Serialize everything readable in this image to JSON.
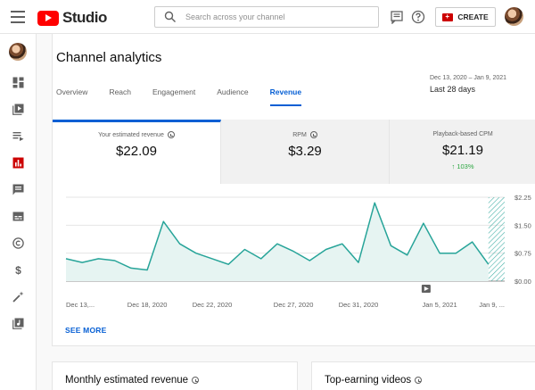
{
  "header": {
    "app_name": "Studio",
    "search_placeholder": "Search across your channel",
    "create_label": "CREATE"
  },
  "sidebar": {
    "items": [
      {
        "name": "dashboard",
        "active": false
      },
      {
        "name": "content",
        "active": false
      },
      {
        "name": "playlists",
        "active": false
      },
      {
        "name": "analytics",
        "active": true
      },
      {
        "name": "comments",
        "active": false
      },
      {
        "name": "subtitles",
        "active": false
      },
      {
        "name": "copyright",
        "active": false
      },
      {
        "name": "monetization",
        "active": false
      },
      {
        "name": "customization",
        "active": false
      },
      {
        "name": "audio-library",
        "active": false
      }
    ]
  },
  "page": {
    "title": "Channel analytics",
    "tabs": [
      {
        "label": "Overview",
        "active": false
      },
      {
        "label": "Reach",
        "active": false
      },
      {
        "label": "Engagement",
        "active": false
      },
      {
        "label": "Audience",
        "active": false
      },
      {
        "label": "Revenue",
        "active": true
      }
    ],
    "range_dates": "Dec 13, 2020 – Jan 9, 2021",
    "range_label": "Last 28 days",
    "see_more": "SEE MORE"
  },
  "metrics": [
    {
      "title": "Your estimated revenue",
      "value": "$22.09",
      "delta": ""
    },
    {
      "title": "RPM",
      "value": "$3.29",
      "delta": ""
    },
    {
      "title": "Playback-based CPM",
      "value": "$21.19",
      "delta": "103%"
    }
  ],
  "colors": {
    "accent": "#065fd4",
    "brand": "#ff0000",
    "line": "#27a499",
    "positive": "#2ba640"
  },
  "chart_data": {
    "type": "area",
    "x": [
      "Dec 13, 2020",
      "Dec 14, 2020",
      "Dec 15, 2020",
      "Dec 16, 2020",
      "Dec 17, 2020",
      "Dec 18, 2020",
      "Dec 19, 2020",
      "Dec 20, 2020",
      "Dec 21, 2020",
      "Dec 22, 2020",
      "Dec 23, 2020",
      "Dec 24, 2020",
      "Dec 25, 2020",
      "Dec 26, 2020",
      "Dec 27, 2020",
      "Dec 28, 2020",
      "Dec 29, 2020",
      "Dec 30, 2020",
      "Dec 31, 2020",
      "Jan 1, 2021",
      "Jan 2, 2021",
      "Jan 3, 2021",
      "Jan 4, 2021",
      "Jan 5, 2021",
      "Jan 6, 2021",
      "Jan 7, 2021",
      "Jan 8, 2021",
      "Jan 9, 2021"
    ],
    "x_tick_labels": [
      "Dec 13,...",
      "Dec 18, 2020",
      "Dec 22, 2020",
      "Dec 27, 2020",
      "Dec 31, 2020",
      "Jan 5, 2021",
      "Jan 9, ..."
    ],
    "x_tick_index": [
      0,
      5,
      9,
      14,
      18,
      23,
      27
    ],
    "series": [
      {
        "values": [
          0.6,
          0.5,
          0.6,
          0.55,
          0.35,
          0.3,
          1.6,
          1.0,
          0.75,
          0.6,
          0.45,
          0.85,
          0.6,
          1.0,
          0.8,
          0.55,
          0.85,
          1.0,
          0.5,
          2.1,
          0.95,
          0.7,
          1.55,
          0.75,
          0.75,
          1.05,
          0.45
        ]
      }
    ],
    "ylim": [
      0,
      2.25
    ],
    "y_ticks": [
      0,
      0.75,
      1.5,
      2.25
    ],
    "y_tick_labels": [
      "$0.00",
      "$0.75",
      "$1.50",
      "$2.25"
    ],
    "partial_last_day": true,
    "grid": true,
    "xlabel": "",
    "ylabel": ""
  }
}
